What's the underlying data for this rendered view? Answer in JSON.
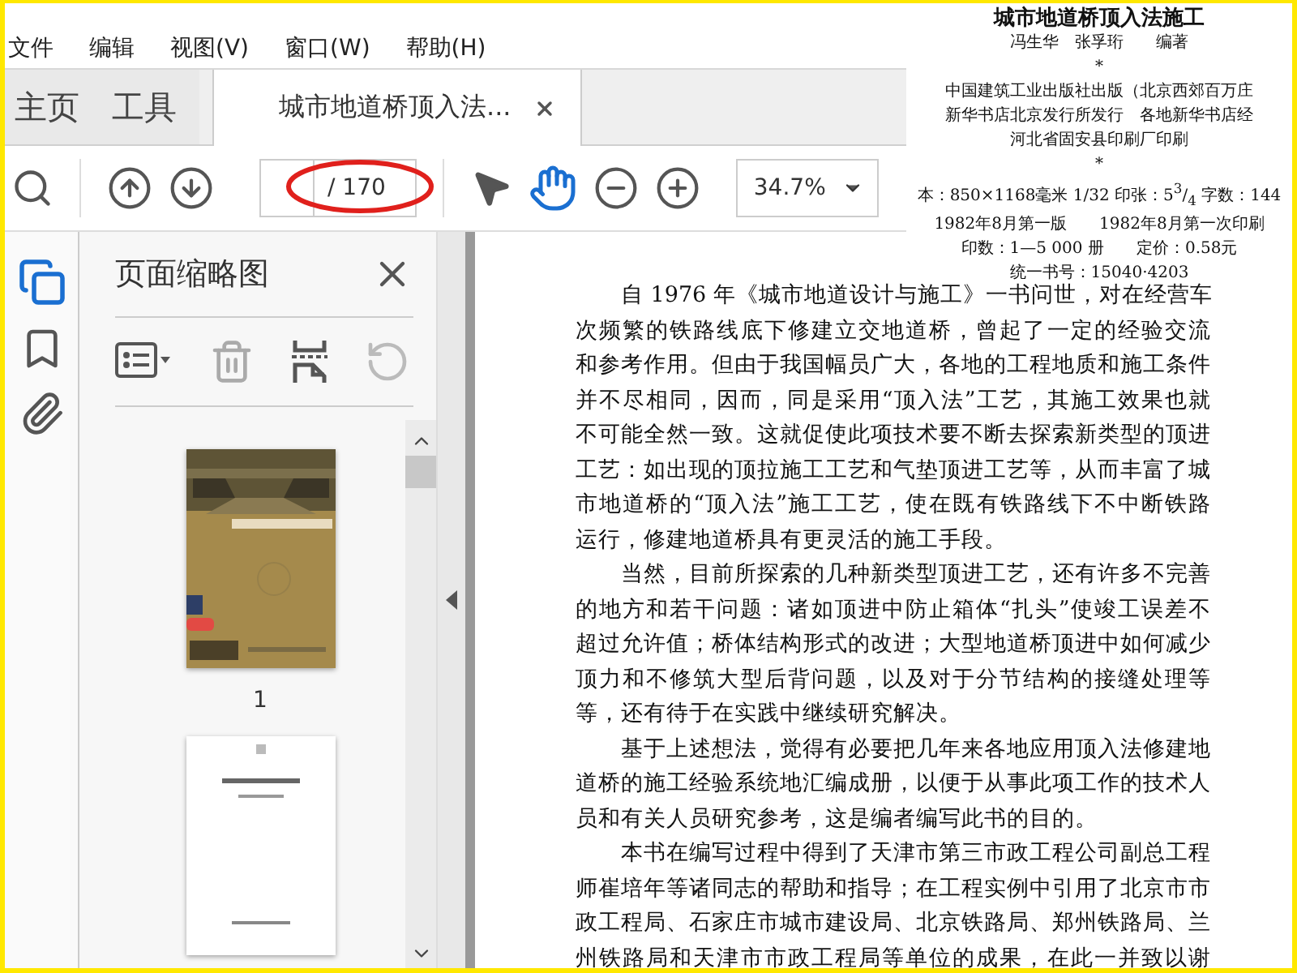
{
  "menu": [
    "文件",
    "编辑",
    "视图(V)",
    "窗口(W)",
    "帮助(H)"
  ],
  "tabs": [
    {
      "label": "主页",
      "selected": false,
      "kind": "nav"
    },
    {
      "label": "工具",
      "selected": false,
      "kind": "nav"
    },
    {
      "label": "城市地道桥顶入法...",
      "selected": true,
      "kind": "document"
    }
  ],
  "toolbar": {
    "page_total": "/ 170",
    "zoom": "34.7%",
    "hand_tool_selected": true
  },
  "annotation": {
    "kind": "ellipse"
  },
  "sidebar": {
    "rail": [
      {
        "kind": "pages",
        "selected": true
      },
      {
        "kind": "bookmarks",
        "selected": false
      },
      {
        "kind": "attachments",
        "selected": false
      }
    ],
    "title": "页面缩略图",
    "thumbnails": [
      {
        "kind": "cover",
        "label": "1"
      },
      {
        "kind": "text_page"
      }
    ]
  },
  "document": {
    "paragraphs": [
      [
        "自 1976 年《城市地道设计与施工》一书问世，对在经营车",
        "次频繁的铁路线底下修建立交地道桥，曾起了一定的经验交流",
        "和参考作用。但由于我国幅员广大，各地的工程地质和施工条件",
        "并不尽相同，因而，同是采用“顶入法”工艺，其施工效果也就",
        "不可能全然一致。这就促使此项技术要不断去探索新类型的顶进",
        "工艺：如出现的顶拉施工工艺和气垫顶进工艺等，从而丰富了城",
        "市地道桥的“顶入法”施工工艺，使在既有铁路线下不中断铁路",
        "运行，修建地道桥具有更灵活的施工手段。"
      ],
      [
        "当然，目前所探索的几种新类型顶进工艺，还有许多不完善",
        "的地方和若干问题：诸如顶进中防止箱体“扎头”使竣工误差不",
        "超过允许值；桥体结构形式的改进；大型地道桥顶进中如何减少",
        "顶力和不修筑大型后背问题，以及对于分节结构的接缝处理等",
        "等，还有待于在实践中继续研究解决。"
      ],
      [
        "基于上述想法，觉得有必要把几年来各地应用顶入法修建地",
        "道桥的施工经验系统地汇编成册，以便于从事此项工作的技术人",
        "员和有关人员研究参考，这是编者编写此书的目的。"
      ],
      [
        "本书在编写过程中得到了天津市第三市政工程公司副总工程",
        "师崔培年等诸同志的帮助和指导；在工程实例中引用了北京市市",
        "政工程局、石家庄市城市建设局、北京铁路局、郑州铁路局、兰",
        "州铁路局和天津市市政工程局等单位的成果，在此一并致以谢"
      ]
    ]
  },
  "inset": {
    "lines": [
      {
        "kind": "heading",
        "text": "城市地道桥顶入法施工"
      },
      {
        "kind": "line",
        "text": "冯生华　张孚珩　　编著"
      },
      {
        "kind": "line",
        "text": "*"
      },
      {
        "kind": "line",
        "text": "中国建筑工业出版社出版（北京西郊百万庄"
      },
      {
        "kind": "line",
        "text": "新华书店北京发行所发行　各地新华书店经"
      },
      {
        "kind": "line",
        "text": "河北省固安县印刷厂印刷"
      },
      {
        "kind": "line",
        "text": "*"
      },
      {
        "kind": "line",
        "text": "本：850×1168毫米 1/32 印张：5$^{3}$/$_{4}$ 字数：144"
      },
      {
        "kind": "line",
        "text": "1982年8月第一版　　1982年8月第一次印刷"
      },
      {
        "kind": "line",
        "text": "印数：1—5 000 册　　定价：0.58元"
      },
      {
        "kind": "line",
        "text": "统一书号：15040·4203"
      }
    ]
  }
}
